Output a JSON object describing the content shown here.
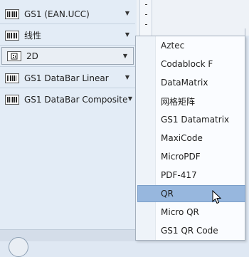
{
  "menu": {
    "items": [
      {
        "label": "GS1 (EAN.UCC)",
        "icon": "gs1-barcode-icon"
      },
      {
        "label": "线性",
        "icon": "linear-barcode-icon"
      },
      {
        "label": "2D",
        "icon": "2d-barcode-icon"
      },
      {
        "label": "GS1 DataBar Linear",
        "icon": "databar-linear-icon"
      },
      {
        "label": "GS1 DataBar Composite",
        "icon": "databar-composite-icon"
      }
    ],
    "arrow_glyph": "▼"
  },
  "submenu": {
    "items": [
      "Aztec",
      "Codablock F",
      "DataMatrix",
      "网格矩阵",
      "GS1 Datamatrix",
      "MaxiCode",
      "MicroPDF",
      "PDF-417",
      "QR",
      "Micro QR",
      "GS1 QR Code"
    ],
    "highlighted": "QR"
  },
  "colors": {
    "highlight": "#97b7de",
    "panel": "#e3ecf6"
  }
}
